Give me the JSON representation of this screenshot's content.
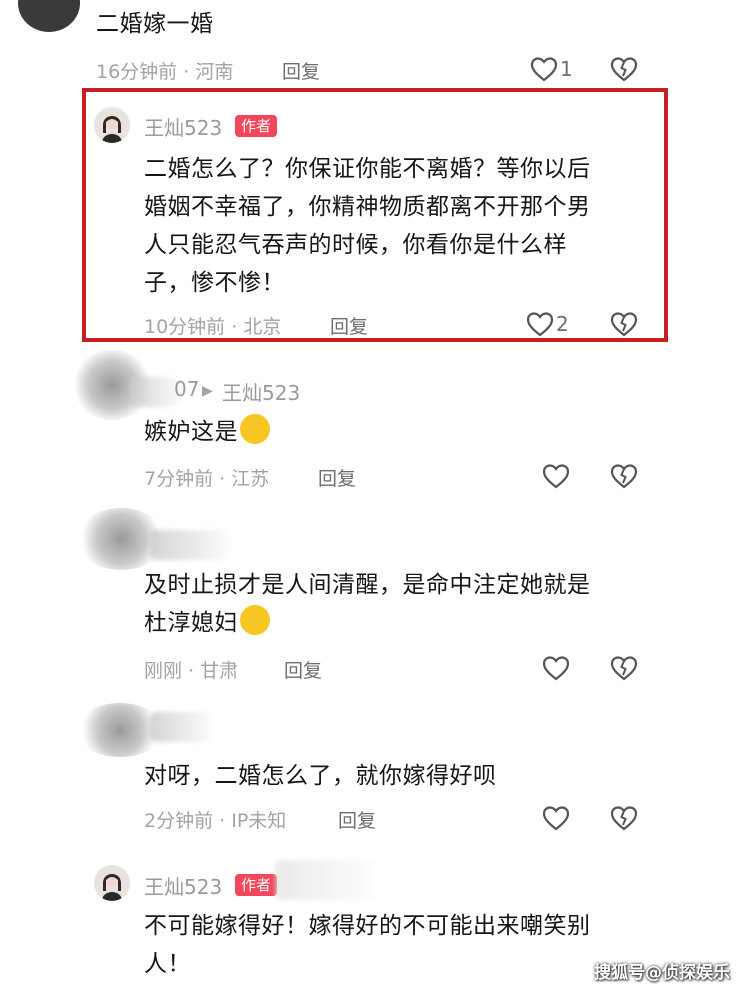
{
  "comments": [
    {
      "text": "二婚嫁一婚",
      "time": "16分钟前",
      "location": "河南",
      "reply": "回复",
      "likes": "1"
    },
    {
      "username": "王灿523",
      "badge": "作者",
      "text_lines": [
        "二婚怎么了？你保证你能不离婚？等你以后",
        "婚姻不幸福了，你精神物质都离不开那个男",
        "人只能忍气吞声的时候，你看你是什么样",
        "子，惨不惨！"
      ],
      "time": "10分钟前",
      "location": "北京",
      "reply": "回复",
      "likes": "2"
    },
    {
      "username_partial": "07",
      "reply_to": "王灿523",
      "text": "嫉妒这是",
      "time": "7分钟前",
      "location": "江苏",
      "reply": "回复"
    },
    {
      "text_lines": [
        "及时止损才是人间清醒，是命中注定她就是",
        "杜淳媳妇"
      ],
      "time": "刚刚",
      "location": "甘肃",
      "reply": "回复"
    },
    {
      "text": "对呀，二婚怎么了，就你嫁得好呗",
      "time": "2分钟前",
      "location": "IP未知",
      "reply": "回复"
    },
    {
      "username": "王灿523",
      "badge": "作者",
      "text_lines": [
        "不可能嫁得好！嫁得好的不可能出来嘲笑别",
        "人！"
      ]
    }
  ],
  "meta_separator": "·",
  "watermark": "搜狐号@侦探娱乐",
  "icons": {
    "like": "heart-outline-icon",
    "dislike": "broken-heart-icon"
  },
  "colors": {
    "highlight_border": "#c71f1f",
    "badge": "#f2475a"
  }
}
